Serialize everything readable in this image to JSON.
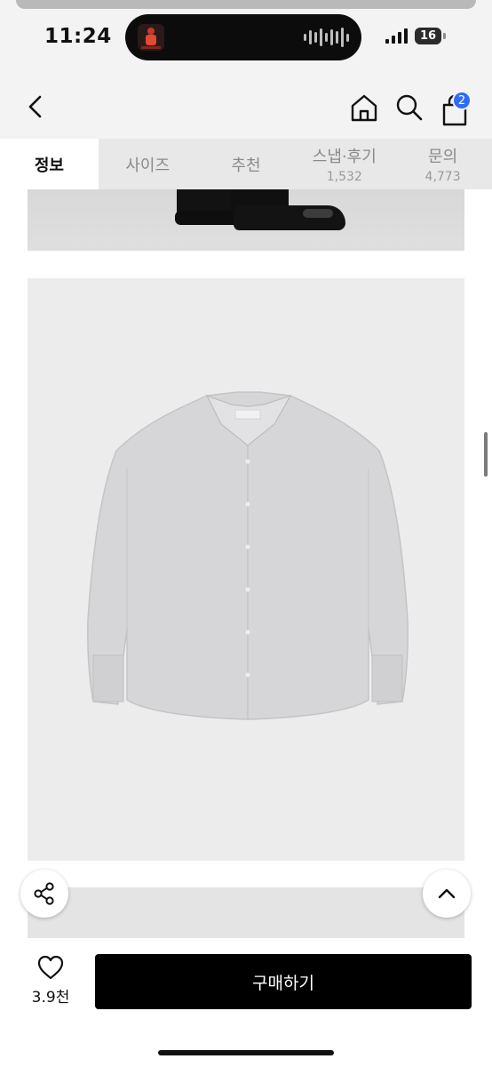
{
  "status_bar": {
    "time": "11:24",
    "battery": "16"
  },
  "header": {
    "cart_badge": "2"
  },
  "tabs": [
    {
      "label": "정보",
      "count": ""
    },
    {
      "label": "사이즈",
      "count": ""
    },
    {
      "label": "추천",
      "count": ""
    },
    {
      "label": "스냅·후기",
      "count": "1,532"
    },
    {
      "label": "문의",
      "count": "4,773"
    }
  ],
  "bottom_bar": {
    "like_count": "3.9천",
    "buy_label": "구매하기"
  },
  "colors": {
    "accent_badge": "#2f6bf6",
    "buy_button": "#000000"
  },
  "icons": [
    "back-arrow-icon",
    "home-icon",
    "search-icon",
    "shopping-bag-icon",
    "share-icon",
    "chevron-up-icon",
    "heart-icon"
  ]
}
